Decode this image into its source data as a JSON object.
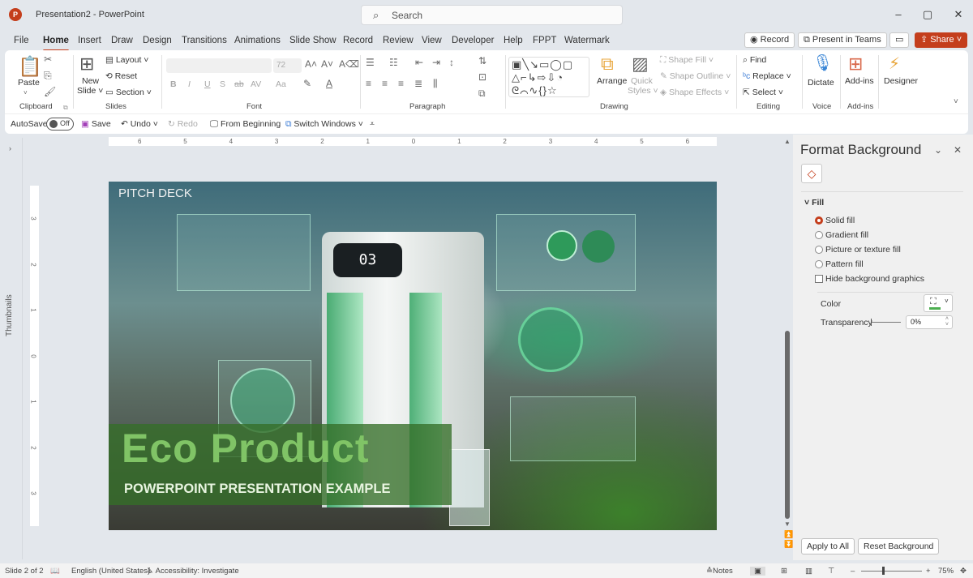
{
  "app": {
    "logo_letter": "P",
    "window_title": "Presentation2 - PowerPoint",
    "search_placeholder": "Search",
    "window_controls": {
      "minimize": "–",
      "restore": "▢",
      "close": "✕"
    }
  },
  "menu": {
    "tabs": [
      "File",
      "Home",
      "Insert",
      "Draw",
      "Design",
      "Transitions",
      "Animations",
      "Slide Show",
      "Record",
      "Review",
      "View",
      "Developer",
      "Help",
      "FPPT",
      "Watermark"
    ],
    "active_tab": "Home",
    "record_label": "Record",
    "present_teams_label": "Present in Teams",
    "share_label": "Share"
  },
  "ribbon": {
    "clipboard": {
      "paste": "Paste",
      "group": "Clipboard"
    },
    "slides": {
      "new_slide_line1": "New",
      "new_slide_line2": "Slide",
      "layout": "Layout",
      "reset": "Reset",
      "section": "Section",
      "group": "Slides"
    },
    "font": {
      "font_name": "",
      "font_size": "72",
      "bold": "B",
      "italic": "I",
      "underline": "U",
      "shadow": "S",
      "strike": "ab",
      "spacing": "AV",
      "case": "Aa",
      "group": "Font"
    },
    "paragraph": {
      "group": "Paragraph"
    },
    "drawing": {
      "arrange": "Arrange",
      "quick_styles_1": "Quick",
      "quick_styles_2": "Styles",
      "shape_fill": "Shape Fill",
      "shape_outline": "Shape Outline",
      "shape_effects": "Shape Effects",
      "group": "Drawing"
    },
    "editing": {
      "find": "Find",
      "replace": "Replace",
      "select": "Select",
      "group": "Editing"
    },
    "voice": {
      "dictate": "Dictate",
      "group": "Voice"
    },
    "addins": {
      "addins": "Add-ins",
      "group": "Add-ins"
    },
    "designer": {
      "designer": "Designer"
    }
  },
  "qat": {
    "autosave": "AutoSave",
    "autosave_state": "Off",
    "save": "Save",
    "undo": "Undo",
    "redo": "Redo",
    "from_beginning": "From Beginning",
    "switch_windows": "Switch Windows"
  },
  "thumbnails_label": "Thumbnails",
  "ruler": {
    "horizontal": [
      "6",
      "5",
      "4",
      "3",
      "2",
      "1",
      "0",
      "1",
      "2",
      "3",
      "4",
      "5",
      "6"
    ],
    "vertical": [
      "3",
      "2",
      "1",
      "0",
      "1",
      "2",
      "3"
    ]
  },
  "slide": {
    "tag": "PITCH DECK",
    "title": "Eco Product",
    "subtitle": "POWERPOINT PRESENTATION EXAMPLE",
    "display_readout": "03"
  },
  "format_pane": {
    "title": "Format Background",
    "section": "Fill",
    "options": [
      {
        "label": "Solid fill",
        "selected": true
      },
      {
        "label": "Gradient fill",
        "selected": false
      },
      {
        "label": "Picture or texture fill",
        "selected": false
      },
      {
        "label": "Pattern fill",
        "selected": false
      }
    ],
    "hide_bg_graphics": "Hide background graphics",
    "hide_bg_checked": false,
    "color_label": "Color",
    "color_value": "#4caf50",
    "transparency_label": "Transparency",
    "transparency_value": "0%",
    "apply_all": "Apply to All",
    "reset_bg": "Reset Background"
  },
  "status": {
    "slide": "Slide 2 of 2",
    "language": "English (United States)",
    "accessibility": "Accessibility: Investigate",
    "notes": "Notes",
    "zoom": "75%"
  },
  "colors": {
    "accent": "#c43e1c",
    "slide_title": "#80c466"
  }
}
